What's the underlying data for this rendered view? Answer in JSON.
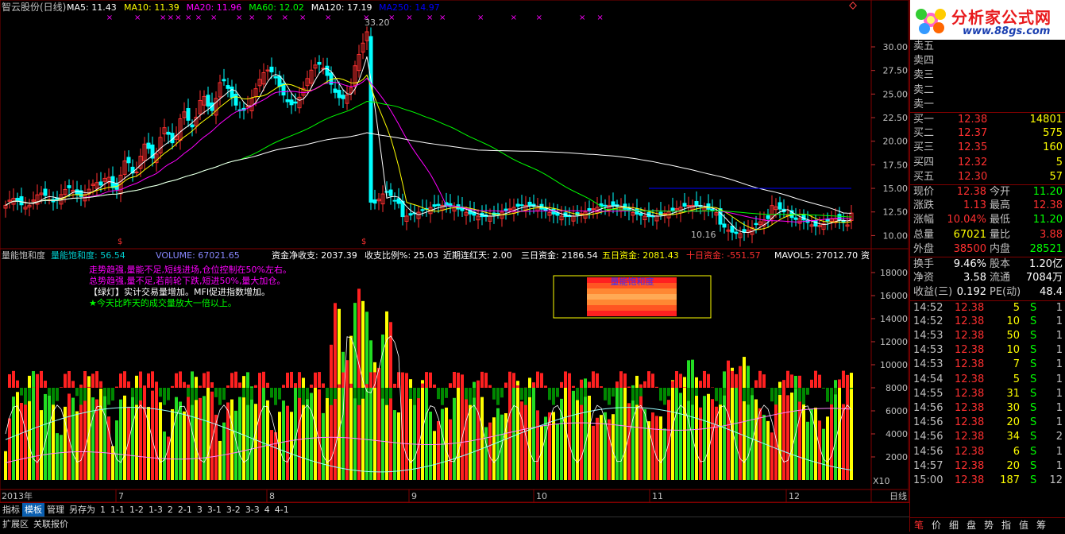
{
  "header": {
    "stock": "智云股份(日线)",
    "ma": [
      {
        "label": "MA5: 11.43",
        "color": "#ffffff"
      },
      {
        "label": "MA10: 11.39",
        "color": "#ffff00"
      },
      {
        "label": "MA20: 11.96",
        "color": "#ff00ff"
      },
      {
        "label": "MA60: 12.02",
        "color": "#00ff00"
      },
      {
        "label": "MA120: 17.19",
        "color": "#ffffff"
      },
      {
        "label": "MA250: 14.97",
        "color": "#0000ff"
      }
    ]
  },
  "price_axis": [
    "30.00",
    "27.50",
    "25.00",
    "22.50",
    "20.00",
    "17.50",
    "15.00",
    "12.50",
    "10.00"
  ],
  "annotations": {
    "high": "33.20",
    "low": "10.16"
  },
  "indicator_header": {
    "name": "量能饱和度",
    "value": "量能饱和度: 56.54",
    "volume": "VOLUME: 67021.65",
    "net": "资金净收支: 2037.39",
    "ratio": "收支比例%: 25.03",
    "days": "近期连红天: 2.00",
    "d3": "三日资金: 2186.54",
    "d5": "五日资金: 2081.43",
    "d10": "十日资金: -551.57",
    "mavol": "MAVOL5: 27012.70",
    "tail": "资"
  },
  "legend": [
    {
      "text": "走势趋强,量能不足,短线进场,仓位控制在50%左右。",
      "color": "#ff00ff"
    },
    {
      "text": "总势趋强,量不足,若前轮下跌,短进50%,量大加仓。",
      "color": "#ff00ff"
    },
    {
      "text": "【绿灯】实计交易量增加。MFI促进指数增加。",
      "color": "#ffffff"
    },
    {
      "text": "★今天比昨天的成交量放大一倍以上。",
      "color": "#00ff00"
    }
  ],
  "box_label": "量能饱和度",
  "vol_axis": [
    "18000",
    "16000",
    "14000",
    "12000",
    "10000",
    "8000",
    "6000",
    "4000",
    "2000"
  ],
  "x10": "X10",
  "date_axis": {
    "year": "2013年",
    "months": [
      "7",
      "8",
      "9",
      "10",
      "11",
      "12"
    ],
    "period": "日线"
  },
  "bottom_tabs": {
    "row1": [
      "指标",
      "模板",
      "管理",
      "另存为",
      "1",
      "1-1",
      "1-2",
      "1-3",
      "2",
      "2-1",
      "3",
      "3-1",
      "3-2",
      "3-3",
      "4",
      "4-1"
    ],
    "row2": [
      "扩展区",
      "关联报价"
    ]
  },
  "logo": {
    "title": "分析家公式网",
    "url": "www.88gs.com"
  },
  "order_book": {
    "sell": [
      "卖五",
      "卖四",
      "卖三",
      "卖二",
      "卖一"
    ],
    "buy": [
      {
        "label": "买一",
        "price": "12.38",
        "vol": "14801"
      },
      {
        "label": "买二",
        "price": "12.37",
        "vol": "575"
      },
      {
        "label": "买三",
        "price": "12.35",
        "vol": "160"
      },
      {
        "label": "买四",
        "price": "12.32",
        "vol": "5"
      },
      {
        "label": "买五",
        "price": "12.30",
        "vol": "57"
      }
    ]
  },
  "quote": [
    {
      "l1": "现价",
      "v1": "12.38",
      "c1": "#ff3030",
      "l2": "今开",
      "v2": "11.20",
      "c2": "#00ff00"
    },
    {
      "l1": "涨跌",
      "v1": "1.13",
      "c1": "#ff3030",
      "l2": "最高",
      "v2": "12.38",
      "c2": "#ff3030"
    },
    {
      "l1": "涨幅",
      "v1": "10.04%",
      "c1": "#ff3030",
      "l2": "最低",
      "v2": "11.20",
      "c2": "#00ff00"
    },
    {
      "l1": "总量",
      "v1": "67021",
      "c1": "#ffff00",
      "l2": "量比",
      "v2": "3.88",
      "c2": "#ff3030"
    },
    {
      "l1": "外盘",
      "v1": "38500",
      "c1": "#ff3030",
      "l2": "内盘",
      "v2": "28521",
      "c2": "#00ff00"
    }
  ],
  "stats": [
    {
      "l1": "换手",
      "v1": "9.46%",
      "l2": "股本",
      "v2": "1.20亿"
    },
    {
      "l1": "净资",
      "v1": "3.58",
      "l2": "流通",
      "v2": "7084万"
    },
    {
      "l1": "收益(三)",
      "v1": "0.192",
      "l2": "PE(动)",
      "v2": "48.4"
    }
  ],
  "ticks": [
    {
      "t": "14:52",
      "p": "12.38",
      "v": "5",
      "s": "S",
      "n": "1"
    },
    {
      "t": "14:52",
      "p": "12.38",
      "v": "10",
      "s": "S",
      "n": "1"
    },
    {
      "t": "14:53",
      "p": "12.38",
      "v": "50",
      "s": "S",
      "n": "1"
    },
    {
      "t": "14:53",
      "p": "12.38",
      "v": "10",
      "s": "S",
      "n": "1"
    },
    {
      "t": "14:53",
      "p": "12.38",
      "v": "7",
      "s": "S",
      "n": "1"
    },
    {
      "t": "14:54",
      "p": "12.38",
      "v": "5",
      "s": "S",
      "n": "1"
    },
    {
      "t": "14:55",
      "p": "12.38",
      "v": "31",
      "s": "S",
      "n": "1"
    },
    {
      "t": "14:56",
      "p": "12.38",
      "v": "30",
      "s": "S",
      "n": "1"
    },
    {
      "t": "14:56",
      "p": "12.38",
      "v": "20",
      "s": "S",
      "n": "1"
    },
    {
      "t": "14:56",
      "p": "12.38",
      "v": "34",
      "s": "S",
      "n": "2"
    },
    {
      "t": "14:56",
      "p": "12.38",
      "v": "6",
      "s": "S",
      "n": "1"
    },
    {
      "t": "14:57",
      "p": "12.38",
      "v": "20",
      "s": "S",
      "n": "1"
    },
    {
      "t": "15:00",
      "p": "12.38",
      "v": "187",
      "s": "S",
      "n": "12"
    }
  ],
  "right_tabs": [
    "笔",
    "价",
    "细",
    "盘",
    "势",
    "指",
    "值",
    "筹"
  ]
}
